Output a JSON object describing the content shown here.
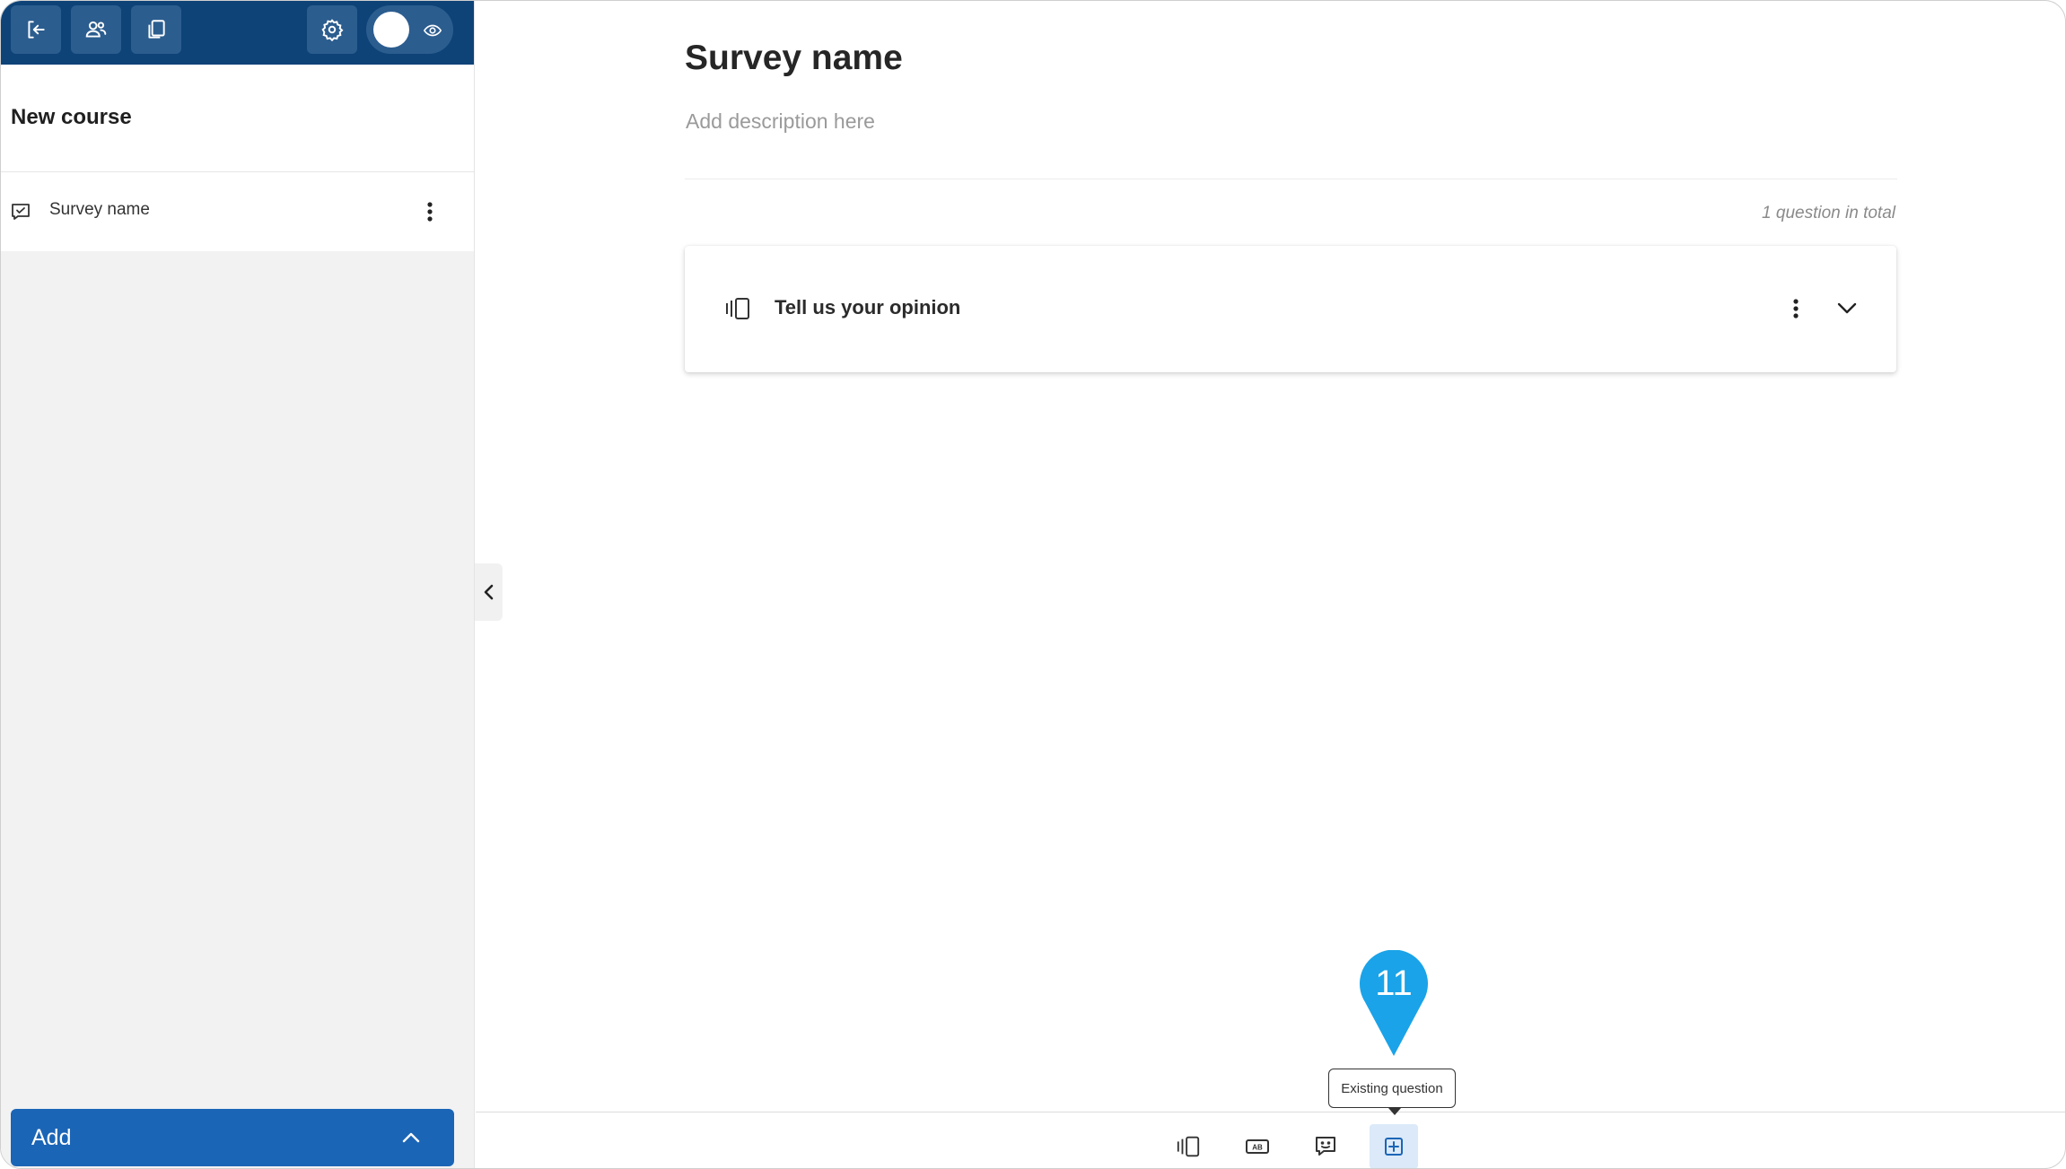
{
  "sidebar": {
    "toolbar": {
      "exit_icon": "exit-icon",
      "users_icon": "users-icon",
      "copy_icon": "copy-icon",
      "settings_icon": "gear-icon",
      "preview_icon": "eye-icon"
    },
    "course_title": "New course",
    "items": [
      {
        "label": "Survey name",
        "icon": "survey-icon"
      }
    ],
    "add_label": "Add"
  },
  "main": {
    "title": "Survey name",
    "description_placeholder": "Add description here",
    "question_count": "1 question in total",
    "questions": [
      {
        "title": "Tell us your opinion",
        "icon": "slider-question-icon"
      }
    ]
  },
  "bottom_toolbar": {
    "buttons": [
      {
        "icon": "slider-question-icon"
      },
      {
        "icon": "text-question-icon"
      },
      {
        "icon": "feedback-question-icon"
      },
      {
        "icon": "add-existing-question-icon",
        "active": true
      }
    ],
    "tooltip": "Existing question"
  },
  "annotation": {
    "step_number": "11",
    "color": "#1aa3e8"
  },
  "colors": {
    "topbar": "#0e4378",
    "accent": "#1b65b6",
    "active_bg": "#dbe9f8"
  }
}
